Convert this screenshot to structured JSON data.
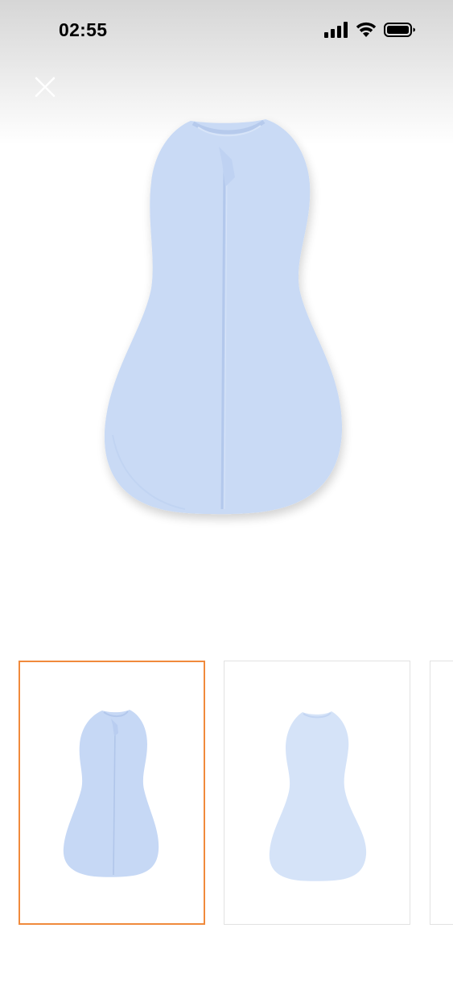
{
  "status_bar": {
    "time": "02:55",
    "icons": [
      "signal-icon",
      "wifi-icon",
      "battery-icon"
    ]
  },
  "header": {
    "close_icon": "close-icon"
  },
  "product_image": {
    "color": "#c8daf5",
    "accent": "#b7cdf0"
  },
  "gallery": {
    "selected_index": 0,
    "selected_border_color": "#f08a3c",
    "thumbnails": [
      {
        "view": "front"
      },
      {
        "view": "back"
      },
      {
        "view": "partial"
      }
    ]
  }
}
